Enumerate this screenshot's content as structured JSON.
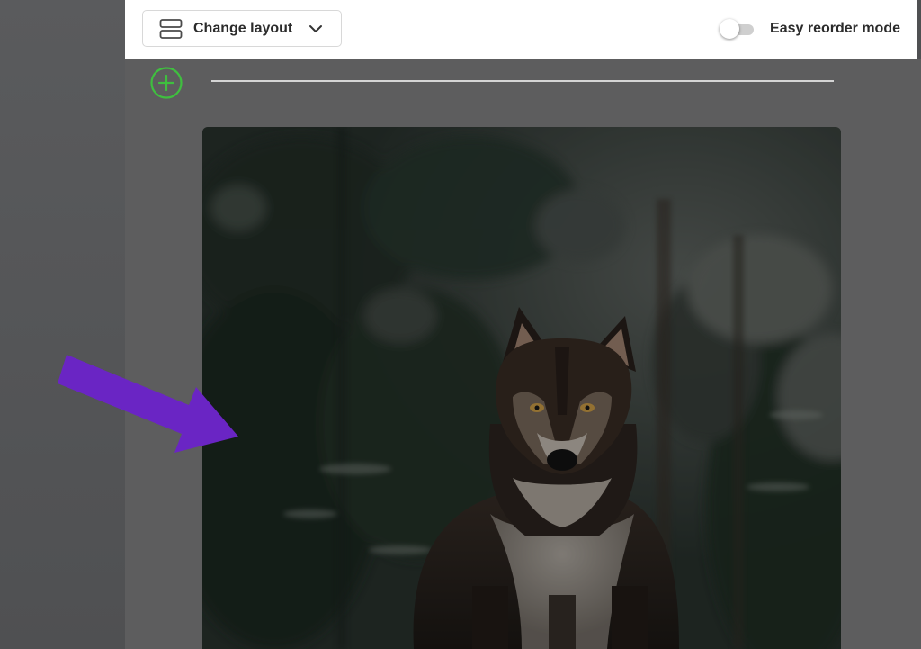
{
  "toolbar": {
    "layout_button_label": "Change layout",
    "layout_icon": "layout-rows-icon",
    "dropdown_icon": "chevron-down-icon",
    "toggle_label": "Easy reorder mode",
    "toggle_on": false
  },
  "canvas": {
    "add_icon": "plus-circle-icon",
    "image_subject": "wolf-dog in forest"
  },
  "colors": {
    "add_accent": "#3fbf3f",
    "arrow": "#6a25c4",
    "toolbar_bg": "#ffffff",
    "canvas_bg": "#5d5d5e"
  }
}
